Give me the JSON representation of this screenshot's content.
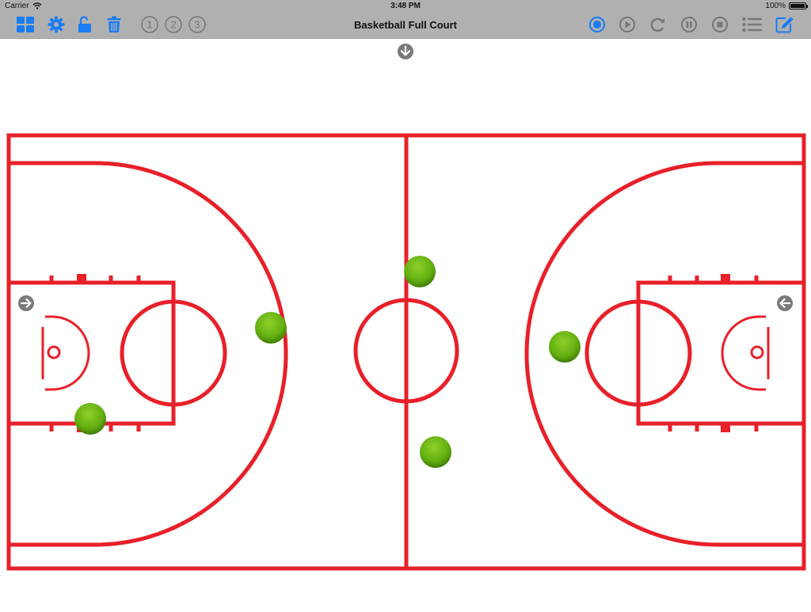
{
  "status_bar": {
    "carrier": "Carrier",
    "time": "3:48 PM",
    "battery": "100%",
    "battery_level": 1.0
  },
  "toolbar": {
    "title": "Basketball Full Court",
    "accent_color": "#1a7cf2",
    "left_buttons": [
      {
        "name": "layout-grid-button",
        "icon": "grid-icon"
      },
      {
        "name": "settings-button",
        "icon": "gear-icon"
      },
      {
        "name": "unlock-button",
        "icon": "unlock-icon"
      },
      {
        "name": "delete-button",
        "icon": "trash-icon"
      }
    ],
    "number_buttons": [
      "1",
      "2",
      "3"
    ],
    "right_buttons": [
      {
        "name": "record-button",
        "icon": "record-icon",
        "active": true
      },
      {
        "name": "play-button",
        "icon": "play-icon"
      },
      {
        "name": "redo-button",
        "icon": "redo-icon"
      },
      {
        "name": "pause-button",
        "icon": "pause-icon"
      },
      {
        "name": "stop-button",
        "icon": "stop-icon"
      },
      {
        "name": "list-button",
        "icon": "list-icon"
      },
      {
        "name": "edit-button",
        "icon": "edit-icon"
      }
    ]
  },
  "court": {
    "line_color": "#e8202a",
    "player_color": "#6bb416",
    "icons": [
      "arrow-down-icon",
      "arrow-right-icon",
      "arrow-left-icon"
    ]
  }
}
